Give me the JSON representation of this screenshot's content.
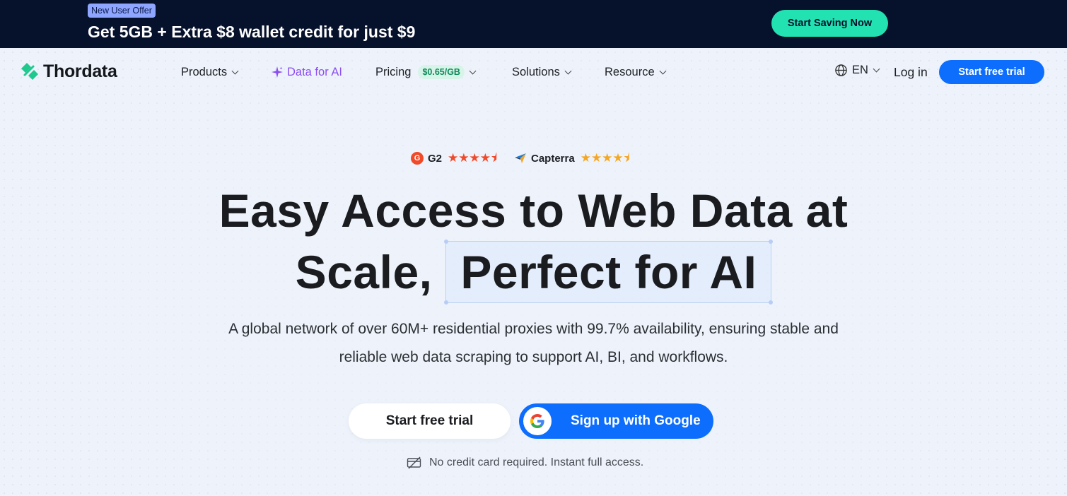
{
  "promo": {
    "badge": "New User Offer",
    "text": "Get 5GB + Extra $8 wallet credit for just $9",
    "button": "Start Saving Now"
  },
  "nav": {
    "logo_text": "Thordata",
    "items": [
      {
        "label": "Products"
      },
      {
        "label": "Data for AI"
      },
      {
        "label": "Pricing",
        "badge": "$0.65/GB"
      },
      {
        "label": "Solutions"
      },
      {
        "label": "Resource"
      }
    ],
    "language": "EN",
    "login": "Log in",
    "trial_button": "Start free trial"
  },
  "ratings": {
    "g2": {
      "name": "G2",
      "stars": "★★★★⯨"
    },
    "capterra": {
      "name": "Capterra",
      "stars": "★★★★⯨"
    }
  },
  "hero": {
    "headline_line1": "Easy Access to Web Data at",
    "headline_line2_part1": "Scale,",
    "headline_line2_highlight": "Perfect for AI",
    "subtext_line1": "A global network of over 60M+ residential proxies with 99.7% availability, ensuring stable and",
    "subtext_line2": "reliable web data scraping to support AI, BI, and workflows.",
    "cta_trial": "Start free trial",
    "cta_google": "Sign up with Google",
    "note": "No credit card required. Instant full access."
  },
  "colors": {
    "promo_bg": "#06112b",
    "accent_teal": "#23e2b2",
    "primary_blue": "#0d6efd",
    "ai_purple": "#8b4ff0",
    "g2_red": "#f04a2a",
    "capterra_orange": "#f5a623"
  }
}
